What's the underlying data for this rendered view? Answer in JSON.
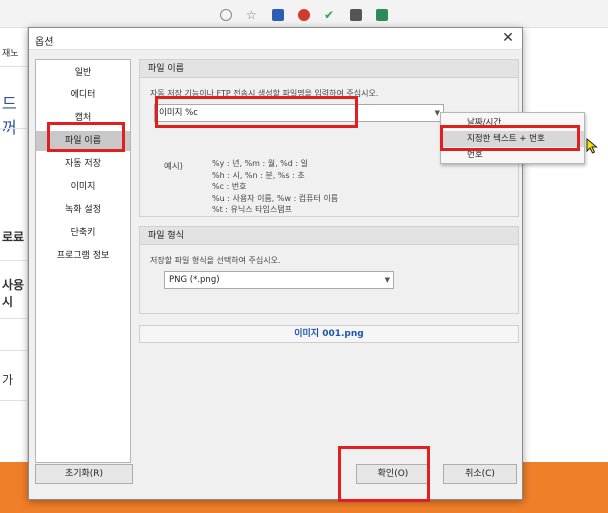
{
  "background": {
    "left_fragments": [
      "재노",
      "드꺼",
      "로료",
      "사용시",
      "가"
    ]
  },
  "dialog": {
    "title": "옵션",
    "close_symbol": "✕"
  },
  "nav": {
    "items": [
      {
        "label": "일반"
      },
      {
        "label": "에디터"
      },
      {
        "label": "캡처"
      },
      {
        "label": "파일 이름",
        "selected": true
      },
      {
        "label": "자동 저장"
      },
      {
        "label": "이미지"
      },
      {
        "label": "녹화 설정"
      },
      {
        "label": "단축키"
      },
      {
        "label": "프로그램 정보"
      }
    ]
  },
  "filename_panel": {
    "header": "파일 이름",
    "description": "자동 저장 기능이나 FTP 전송시 생성할 파일명을 입력하여 주십시오.",
    "input_value": "이미지 %c",
    "example_label": "예시)",
    "examples": [
      "%y : 년, %m : 월, %d : 일",
      "%h : 시, %n : 분, %s : 초",
      "%c : 번호",
      "%u : 사용자 이름, %w : 컴퓨터 이름",
      "%t : 유닉스 타임스탬프"
    ]
  },
  "filetype_panel": {
    "header": "파일 형식",
    "description": "저장할 파일 형식을 선택하여 주십시오.",
    "selected_format": "PNG (*.png)"
  },
  "preview_filename": "이미지 001.png",
  "buttons": {
    "reset": "초기화(R)",
    "ok": "확인(O)",
    "cancel": "취소(C)"
  },
  "popup_menu": {
    "items": [
      {
        "label": "날짜/시간"
      },
      {
        "label": "지정한 텍스트 + 번호",
        "highlighted": true
      },
      {
        "label": "번호"
      }
    ]
  },
  "colors": {
    "annotation": "#e02020",
    "accent_orange": "#f07f2a",
    "preview_text": "#1d56a8"
  }
}
